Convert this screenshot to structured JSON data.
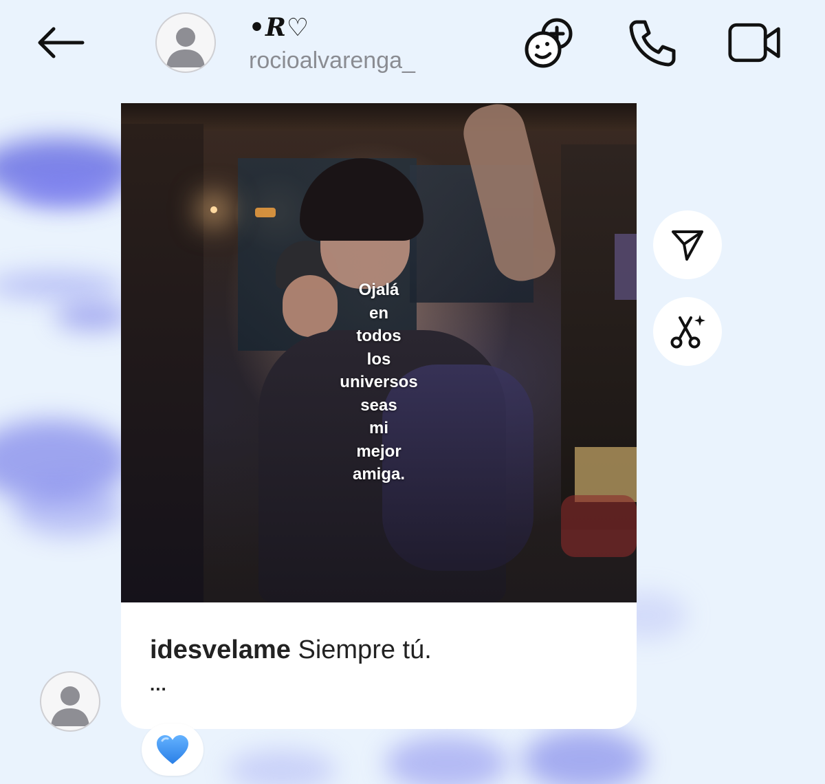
{
  "header": {
    "display_name": "•R♡",
    "username": "rocioalvarenga_",
    "icons": {
      "back": "arrow-left-icon",
      "effects": "gamepad-add-icon",
      "call": "phone-icon",
      "video": "video-camera-icon"
    }
  },
  "message": {
    "overlay_lines": [
      "Ojalá",
      "en",
      "todos",
      "los",
      "universos",
      "seas",
      "mi",
      "mejor",
      "amiga."
    ],
    "post_author": "idesvelame",
    "post_caption": "Siempre tú.",
    "caption_more": "...",
    "reaction_emoji": "💙"
  },
  "side_actions": {
    "share_icon": "send-icon",
    "remix_icon": "scissors-sparkle-icon"
  },
  "colors": {
    "background": "#eaf3fd",
    "watercolor": "#6a6ee6",
    "username_gray": "#8a8c92",
    "heart_blue": "#3b8ff0"
  }
}
